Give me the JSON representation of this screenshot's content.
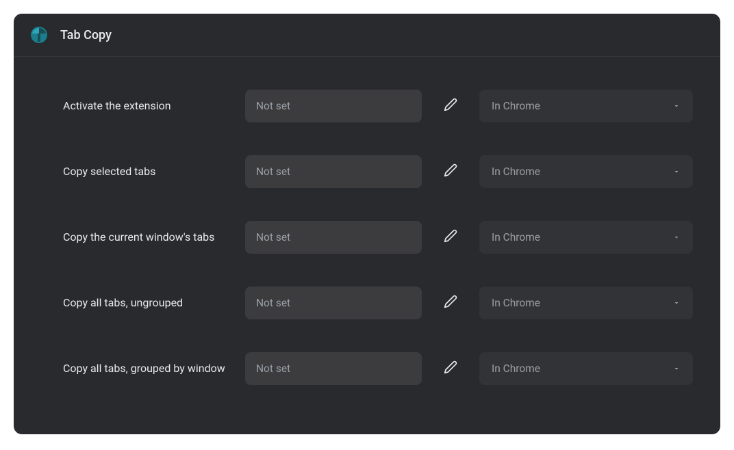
{
  "header": {
    "title": "Tab Copy"
  },
  "rows": [
    {
      "label": "Activate the extension",
      "shortcut": "Not set",
      "scope": "In Chrome"
    },
    {
      "label": "Copy selected tabs",
      "shortcut": "Not set",
      "scope": "In Chrome"
    },
    {
      "label": "Copy the current window's tabs",
      "shortcut": "Not set",
      "scope": "In Chrome"
    },
    {
      "label": "Copy all tabs, ungrouped",
      "shortcut": "Not set",
      "scope": "In Chrome"
    },
    {
      "label": "Copy all tabs, grouped by window",
      "shortcut": "Not set",
      "scope": "In Chrome"
    }
  ]
}
